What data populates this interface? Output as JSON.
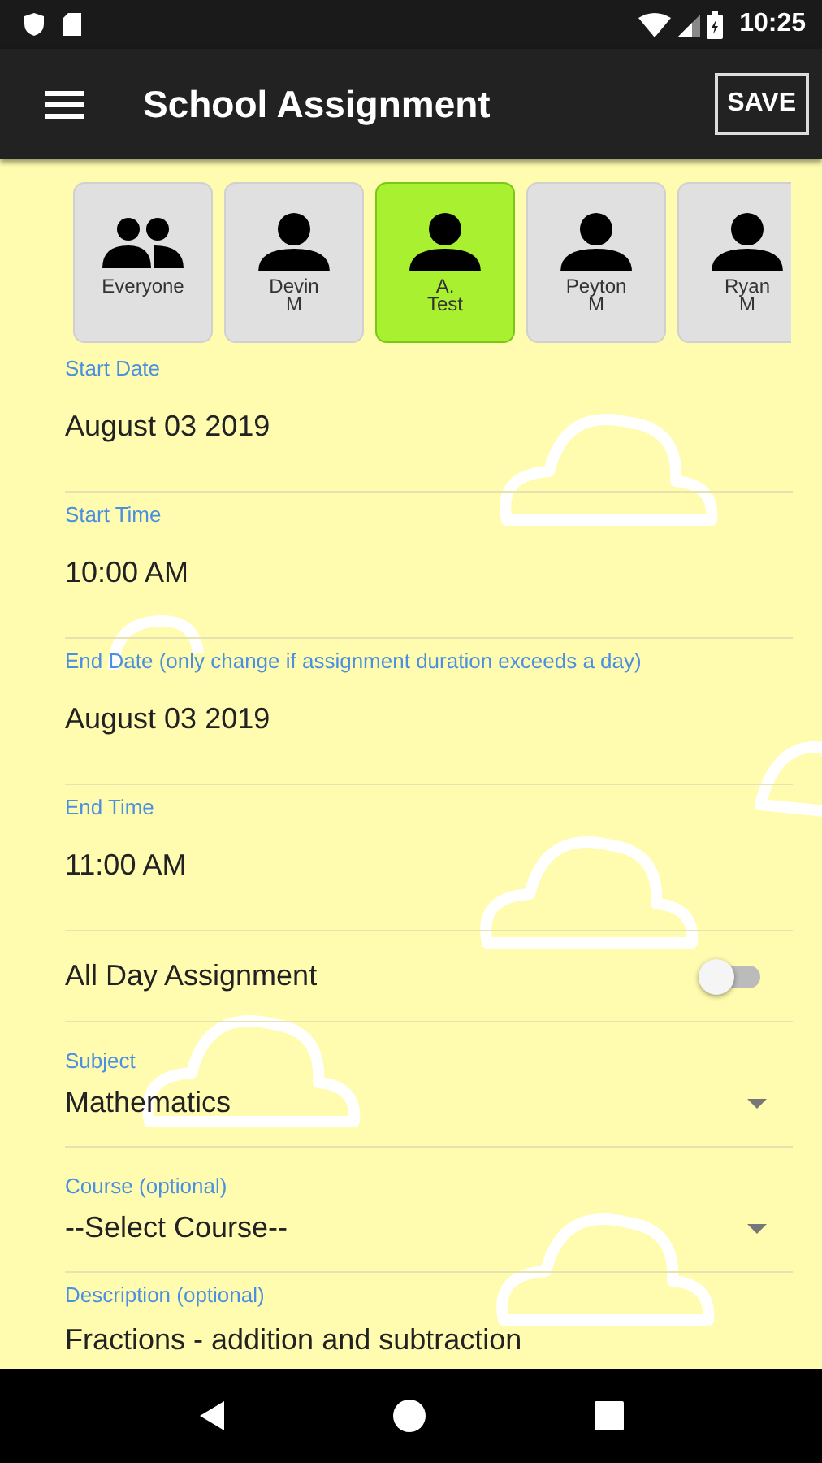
{
  "status_bar": {
    "time": "10:25"
  },
  "app_bar": {
    "title": "School Assignment",
    "action": "SAVE"
  },
  "members": [
    {
      "kind": "group",
      "lines": [
        "Everyone"
      ],
      "selected": false
    },
    {
      "kind": "person",
      "lines": [
        "Devin",
        "M"
      ],
      "selected": false
    },
    {
      "kind": "person",
      "lines": [
        "A.",
        "Test"
      ],
      "selected": true
    },
    {
      "kind": "person",
      "lines": [
        "Peyton",
        "M"
      ],
      "selected": false
    },
    {
      "kind": "person",
      "lines": [
        "Ryan",
        "M"
      ],
      "selected": false
    }
  ],
  "fields": [
    {
      "kind": "text",
      "label": "Start Date",
      "value": "August 03 2019"
    },
    {
      "kind": "text",
      "label": "Start Time",
      "value": "10:00 AM"
    },
    {
      "kind": "text",
      "label": "End Date (only change if assignment duration exceeds a day)",
      "value": "August 03 2019"
    },
    {
      "kind": "text",
      "label": "End Time",
      "value": "11:00 AM"
    },
    {
      "kind": "switch",
      "label": "All Day Assignment",
      "on": false
    },
    {
      "kind": "dropdown",
      "label": "Subject",
      "value": "Mathematics"
    },
    {
      "kind": "dropdown",
      "label": "Course (optional)",
      "value": "--Select Course--"
    },
    {
      "kind": "text",
      "label": "Description (optional)",
      "value": "Fractions - addition and subtraction"
    }
  ]
}
